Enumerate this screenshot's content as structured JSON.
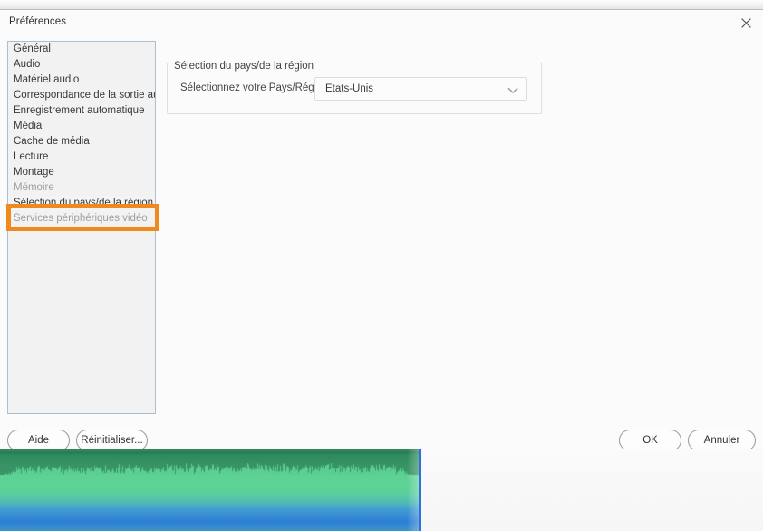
{
  "window": {
    "title": "Préférences",
    "close_icon": "close-icon"
  },
  "sidebar": {
    "items": [
      {
        "label": "Général",
        "selected": false,
        "obscured": false
      },
      {
        "label": "Audio",
        "selected": false,
        "obscured": false
      },
      {
        "label": "Matériel audio",
        "selected": false,
        "obscured": false
      },
      {
        "label": "Correspondance de la sortie audio",
        "selected": false,
        "obscured": false
      },
      {
        "label": "Enregistrement automatique",
        "selected": false,
        "obscured": false
      },
      {
        "label": "Média",
        "selected": false,
        "obscured": false
      },
      {
        "label": "Cache de média",
        "selected": false,
        "obscured": false
      },
      {
        "label": "Lecture",
        "selected": false,
        "obscured": false
      },
      {
        "label": "Montage",
        "selected": false,
        "obscured": false
      },
      {
        "label": "Mémoire",
        "selected": false,
        "obscured": true
      },
      {
        "label": "Sélection du pays/de la région",
        "selected": true,
        "obscured": false
      },
      {
        "label": "Services périphériques vidéo",
        "selected": false,
        "obscured": true
      }
    ]
  },
  "annotation": {
    "color": "#f08a1e",
    "target_label": "Sélection du pays/de la région"
  },
  "content": {
    "group_legend": "Sélection du pays/de la région",
    "field_label": "Sélectionnez votre Pays/Région :",
    "country_select": {
      "value": "Etats-Unis",
      "chevron_icon": "chevron-down-icon"
    }
  },
  "footer": {
    "help_label": "Aide",
    "reset_label": "Réinitialiser...",
    "ok_label": "OK",
    "cancel_label": "Annuler"
  },
  "app_background": {
    "audio_clip": {
      "waveform_color": "#5ed295",
      "base_color": "#2f7fd6",
      "playhead_color": "#2f6fe0"
    }
  }
}
